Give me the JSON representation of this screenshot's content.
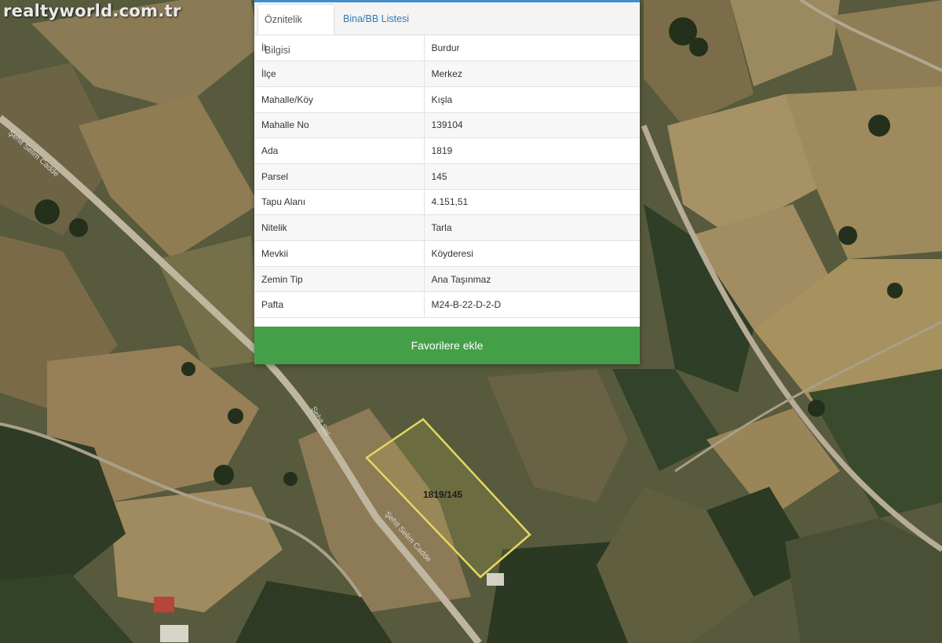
{
  "watermark": "realtyworld.com.tr",
  "tabs": [
    {
      "label": "Öznitelik Bilgisi",
      "active": true
    },
    {
      "label": "Bina/BB Listesi",
      "active": false
    }
  ],
  "attributes": [
    {
      "key": "İl",
      "value": "Burdur"
    },
    {
      "key": "İlçe",
      "value": "Merkez"
    },
    {
      "key": "Mahalle/Köy",
      "value": "Kışla"
    },
    {
      "key": "Mahalle No",
      "value": "139104"
    },
    {
      "key": "Ada",
      "value": "1819"
    },
    {
      "key": "Parsel",
      "value": "145"
    },
    {
      "key": "Tapu Alanı",
      "value": "4.151,51"
    },
    {
      "key": "Nitelik",
      "value": "Tarla"
    },
    {
      "key": "Mevkii",
      "value": "Köyderesi"
    },
    {
      "key": "Zemin Tip",
      "value": "Ana Taşınmaz"
    },
    {
      "key": "Pafta",
      "value": "M24-B-22-D-2-D"
    }
  ],
  "favorite_button": "Favorilere ekle",
  "map": {
    "parcel_label": "1819/145",
    "road_labels": [
      "Şehit Selim Cadde",
      "Şehit Sel",
      "Şehit Selim Cadde"
    ],
    "colors": {
      "parcel_outline": "#e6d860",
      "button": "#44a048",
      "tab_link": "#337ab7",
      "panel_top_border": "#3b8fd1"
    }
  }
}
